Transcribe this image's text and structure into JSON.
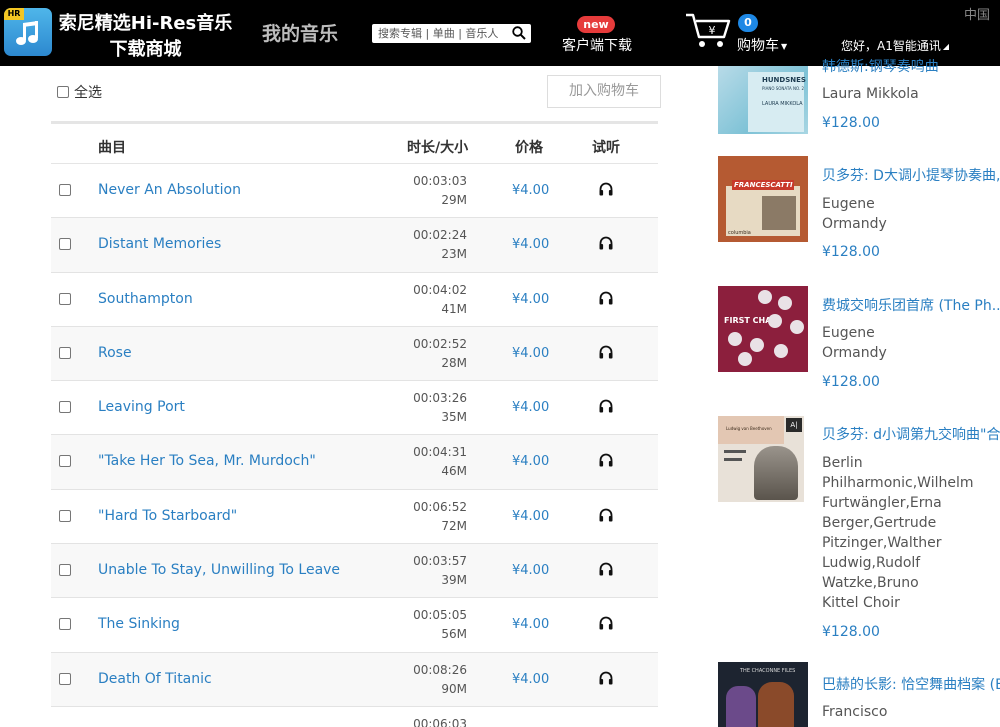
{
  "header": {
    "logo_badge": "HR",
    "brand_line1": "索尼精选Hi-Res音乐",
    "brand_line2": "下载商城",
    "my_music": "我的音乐",
    "search_placeholder": "搜索专辑 | 单曲 | 音乐人",
    "new_badge": "new",
    "client_download": "客户端下载",
    "cart_count": "0",
    "cart_label": "购物车",
    "user_greeting": "您好，A1智能通讯",
    "region": "中国"
  },
  "controls": {
    "select_all": "全选",
    "add_to_cart": "加入购物车"
  },
  "table": {
    "columns": [
      "曲目",
      "时长/大小",
      "价格",
      "试听"
    ],
    "rows": [
      {
        "title": "Never An Absolution",
        "duration": "00:03:03",
        "size": "29M",
        "price": "¥4.00"
      },
      {
        "title": "Distant Memories",
        "duration": "00:02:24",
        "size": "23M",
        "price": "¥4.00"
      },
      {
        "title": "Southampton",
        "duration": "00:04:02",
        "size": "41M",
        "price": "¥4.00"
      },
      {
        "title": "Rose",
        "duration": "00:02:52",
        "size": "28M",
        "price": "¥4.00"
      },
      {
        "title": "Leaving Port",
        "duration": "00:03:26",
        "size": "35M",
        "price": "¥4.00"
      },
      {
        "title": "\"Take Her To Sea, Mr. Murdoch\"",
        "duration": "00:04:31",
        "size": "46M",
        "price": "¥4.00"
      },
      {
        "title": "\"Hard To Starboard\"",
        "duration": "00:06:52",
        "size": "72M",
        "price": "¥4.00"
      },
      {
        "title": "Unable To Stay, Unwilling To Leave",
        "duration": "00:03:57",
        "size": "39M",
        "price": "¥4.00"
      },
      {
        "title": "The Sinking",
        "duration": "00:05:05",
        "size": "56M",
        "price": "¥4.00"
      },
      {
        "title": "Death Of Titanic",
        "duration": "00:08:26",
        "size": "90M",
        "price": "¥4.00"
      },
      {
        "title": "",
        "duration": "00:06:03",
        "size": "",
        "price": ""
      }
    ]
  },
  "sidebar": {
    "albums": [
      {
        "title": "韩德斯:钢琴奏鸣曲",
        "artists": [
          "Laura Mikkola"
        ],
        "price": "¥128.00",
        "cover_text": [
          "HUNDSNES",
          "PIANO SONATA NO. 2",
          "LAURA MIKKOLA"
        ]
      },
      {
        "title": "贝多芬: D大调小提琴协奏曲,",
        "artists": [
          "Eugene",
          "Ormandy"
        ],
        "price": "¥128.00",
        "cover_text": [
          "FRANCESCATTI",
          "columbia"
        ]
      },
      {
        "title": "费城交响乐团首席 (The Ph...",
        "artists": [
          "Eugene",
          "Ormandy"
        ],
        "price": "¥128.00",
        "cover_text": [
          "FIRST CHAIR"
        ]
      },
      {
        "title": "贝多芬: d小调第九交响曲\"合唱\"",
        "artists": [
          "Berlin",
          "Philharmonic,Wilhelm",
          "Furtwängler,Erna",
          "Berger,Gertrude",
          "Pitzinger,Walther",
          "Ludwig,Rudolf",
          "Watzke,Bruno",
          "Kittel Choir"
        ],
        "price": "¥128.00",
        "cover_text": [
          "Ludwig van Beethoven",
          "A|"
        ]
      },
      {
        "title": "巴赫的长影: 恰空舞曲档案 (B...",
        "artists": [
          "Francisco"
        ],
        "price": "",
        "cover_text": [
          "THE CHACONNE FILES"
        ]
      }
    ]
  }
}
